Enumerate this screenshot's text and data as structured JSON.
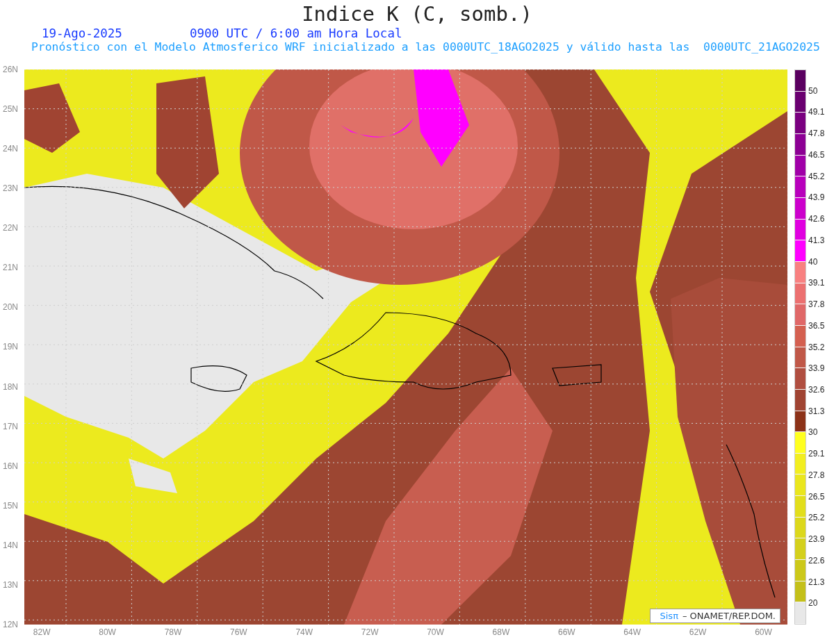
{
  "title": "Indice K (C, somb.)",
  "date": "19-Ago-2025",
  "time": "0900 UTC / 6:00 am Hora Local",
  "forecast_note": "Pronóstico con el Modelo Atmosferico WRF inicializado a las 0000UTC_18AGO2025 y válido hasta las  0000UTC_21AGO2025",
  "lat_labels": [
    "26N",
    "25N",
    "24N",
    "23N",
    "22N",
    "21N",
    "20N",
    "19N",
    "18N",
    "17N",
    "16N",
    "15N",
    "14N",
    "13N",
    "12N"
  ],
  "lon_labels": [
    "82W",
    "80W",
    "78W",
    "76W",
    "74W",
    "72W",
    "70W",
    "68W",
    "66W",
    "64W",
    "62W",
    "60W"
  ],
  "colorbar": [
    {
      "color": "#5a0060",
      "label": "50"
    },
    {
      "color": "#6a0070",
      "label": "49.1"
    },
    {
      "color": "#7a0080",
      "label": "47.8"
    },
    {
      "color": "#8c0094",
      "label": "46.5"
    },
    {
      "color": "#a000a8",
      "label": "45.2"
    },
    {
      "color": "#b800bc",
      "label": "43.9"
    },
    {
      "color": "#cc00cc",
      "label": "42.6"
    },
    {
      "color": "#e000e0",
      "label": "41.3"
    },
    {
      "color": "#ff00ff",
      "label": "40"
    },
    {
      "color": "#f88080",
      "label": "39.1"
    },
    {
      "color": "#ec7070",
      "label": "37.8"
    },
    {
      "color": "#e06868",
      "label": "36.5"
    },
    {
      "color": "#d46050",
      "label": "35.2"
    },
    {
      "color": "#c05848",
      "label": "33.9"
    },
    {
      "color": "#b04e40",
      "label": "32.6"
    },
    {
      "color": "#a04432",
      "label": "31.3"
    },
    {
      "color": "#8c3218",
      "label": "30"
    },
    {
      "color": "#ffff20",
      "label": "29.1"
    },
    {
      "color": "#f2ee20",
      "label": "27.8"
    },
    {
      "color": "#eae61e",
      "label": "26.5"
    },
    {
      "color": "#e2de1c",
      "label": "25.2"
    },
    {
      "color": "#dcd81c",
      "label": "23.9"
    },
    {
      "color": "#d4d01c",
      "label": "22.6"
    },
    {
      "color": "#ccc81a",
      "label": "21.3"
    },
    {
      "color": "#c4c01a",
      "label": "20"
    },
    {
      "color": "#e8e8e8"
    }
  ],
  "credit": {
    "logo": "Sisπ",
    "text": "– ONAMET/REP.DOM."
  }
}
